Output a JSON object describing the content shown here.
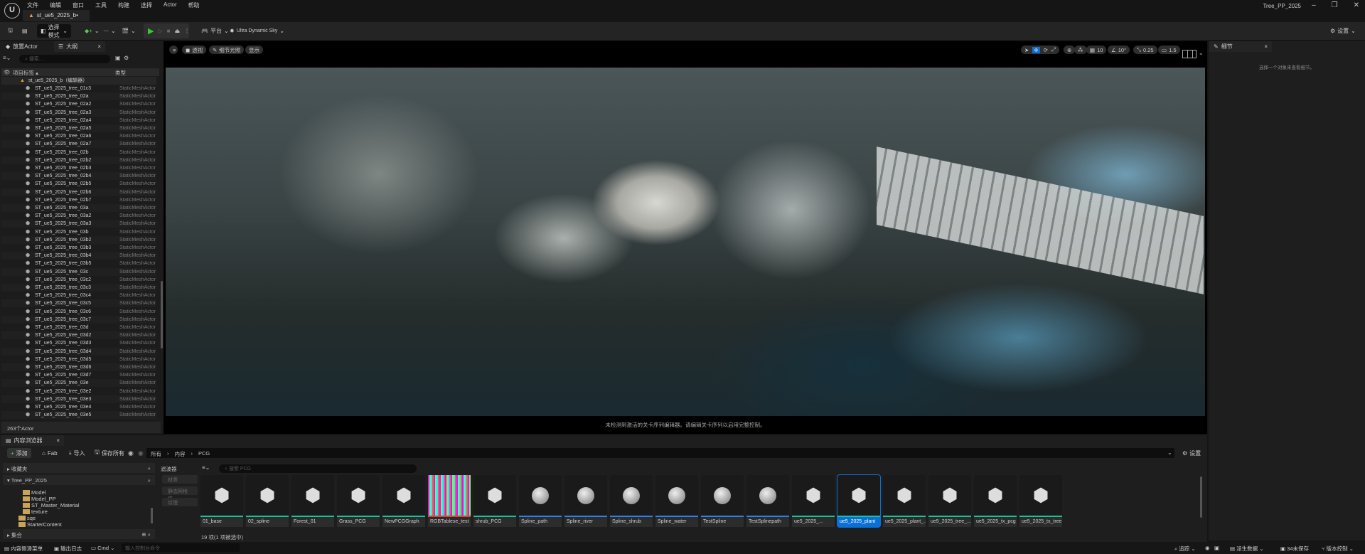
{
  "app": {
    "title": "Tree_PP_2025",
    "menu": [
      "文件",
      "编辑",
      "窗口",
      "工具",
      "构建",
      "选择",
      "Actor",
      "帮助"
    ],
    "doc_tab": "st_ue5_2025_b•"
  },
  "toolbar": {
    "mode": "选择模式",
    "platform": "平台",
    "sky": "Ultra Dynamic Sky",
    "settings": "设置"
  },
  "outliner": {
    "tab_place": "放置Actor",
    "tab_outline": "大纲",
    "search_placeholder": "搜索...",
    "col_label": "项目标签 ▴",
    "col_type": "类型",
    "root": "st_ue5_2025_b（编辑器）",
    "type": "StaticMeshActor",
    "items": [
      "ST_ue5_2025_tree_01c3",
      "ST_ue5_2025_tree_02a",
      "ST_ue5_2025_tree_02a2",
      "ST_ue5_2025_tree_02a3",
      "ST_ue5_2025_tree_02a4",
      "ST_ue5_2025_tree_02a5",
      "ST_ue5_2025_tree_02a6",
      "ST_ue5_2025_tree_02a7",
      "ST_ue5_2025_tree_02b",
      "ST_ue5_2025_tree_02b2",
      "ST_ue5_2025_tree_02b3",
      "ST_ue5_2025_tree_02b4",
      "ST_ue5_2025_tree_02b5",
      "ST_ue5_2025_tree_02b6",
      "ST_ue5_2025_tree_02b7",
      "ST_ue5_2025_tree_03a",
      "ST_ue5_2025_tree_03a2",
      "ST_ue5_2025_tree_03a3",
      "ST_ue5_2025_tree_03b",
      "ST_ue5_2025_tree_03b2",
      "ST_ue5_2025_tree_03b3",
      "ST_ue5_2025_tree_03b4",
      "ST_ue5_2025_tree_03b5",
      "ST_ue5_2025_tree_03c",
      "ST_ue5_2025_tree_03c2",
      "ST_ue5_2025_tree_03c3",
      "ST_ue5_2025_tree_03c4",
      "ST_ue5_2025_tree_03c5",
      "ST_ue5_2025_tree_03c6",
      "ST_ue5_2025_tree_03c7",
      "ST_ue5_2025_tree_03d",
      "ST_ue5_2025_tree_03d2",
      "ST_ue5_2025_tree_03d3",
      "ST_ue5_2025_tree_03d4",
      "ST_ue5_2025_tree_03d5",
      "ST_ue5_2025_tree_03d6",
      "ST_ue5_2025_tree_03d7",
      "ST_ue5_2025_tree_03e",
      "ST_ue5_2025_tree_03e2",
      "ST_ue5_2025_tree_03e3",
      "ST_ue5_2025_tree_03e4",
      "ST_ue5_2025_tree_03e5"
    ],
    "count": "263个Actor"
  },
  "viewport": {
    "menu_btn": "≡",
    "perspective": "透视",
    "lighting": "细节光照",
    "show": "显示",
    "grid": "10",
    "angle": "10°",
    "scale": "0.25",
    "camera": "1.5",
    "message": "未检测到激活的关卡序列编辑器。请编辑关卡序列以启用完整控制。"
  },
  "details": {
    "tab": "细节",
    "empty": "选择一个对象来查看细节。"
  },
  "content": {
    "tab": "内容浏览器",
    "add": "添加",
    "fab": "Fab",
    "import": "导入",
    "save_all": "保存所有",
    "path": [
      "所有",
      "内容",
      "PCG"
    ],
    "settings": "设置",
    "favorites": "收藏夹",
    "project": "Tree_PP_2025",
    "folders": [
      "Model",
      "Model_PP",
      "ST_Master_Material",
      "texture",
      "sqe",
      "StarterContent"
    ],
    "collections": "集合",
    "filters_title": "滤波器",
    "filters": [
      "材质",
      "静态网格体",
      "纹理"
    ],
    "search_placeholder": "搜索 PCG",
    "assets": [
      {
        "name": "01_base",
        "kind": "pcg"
      },
      {
        "name": "02_spline",
        "kind": "pcg"
      },
      {
        "name": "Forest_01",
        "kind": "pcg"
      },
      {
        "name": "Grass_PCG",
        "kind": "pcg"
      },
      {
        "name": "NewPCGGraph",
        "kind": "pcg"
      },
      {
        "name": "RGBTablese_test",
        "kind": "texture"
      },
      {
        "name": "shrub_PCG",
        "kind": "pcg"
      },
      {
        "name": "Spline_path",
        "kind": "blueprint"
      },
      {
        "name": "Spline_river",
        "kind": "blueprint"
      },
      {
        "name": "Spline_shrub",
        "kind": "blueprint"
      },
      {
        "name": "Spline_water",
        "kind": "blueprint"
      },
      {
        "name": "TestSpline",
        "kind": "blueprint"
      },
      {
        "name": "TestSplinepath",
        "kind": "blueprint"
      },
      {
        "name": "ue5_2025_...",
        "kind": "pcg"
      },
      {
        "name": "ue5_2025_plant",
        "kind": "pcg",
        "selected": true
      },
      {
        "name": "ue5_2025_plant_...",
        "kind": "pcg"
      },
      {
        "name": "ue5_2025_tree_...",
        "kind": "pcg"
      },
      {
        "name": "ue5_2025_tx_pcg",
        "kind": "pcg"
      },
      {
        "name": "ue5_2025_tx_tree",
        "kind": "pcg"
      }
    ],
    "count": "19 项(1 项被选中)"
  },
  "statusbar": {
    "drawer": "内容侧滑菜单",
    "log": "输出日志",
    "cmd": "Cmd",
    "cmd_placeholder": "输入控制台命令",
    "trace": "追踪",
    "derived": "派生数据",
    "unsaved": "34未保存",
    "vcs": "版本控制"
  },
  "colors": {
    "pcg": "#19c29b",
    "blueprint": "#2f7fe8",
    "texture": "#d0473c",
    "selected": "#0a70d6",
    "accent": "#0a70d6"
  }
}
